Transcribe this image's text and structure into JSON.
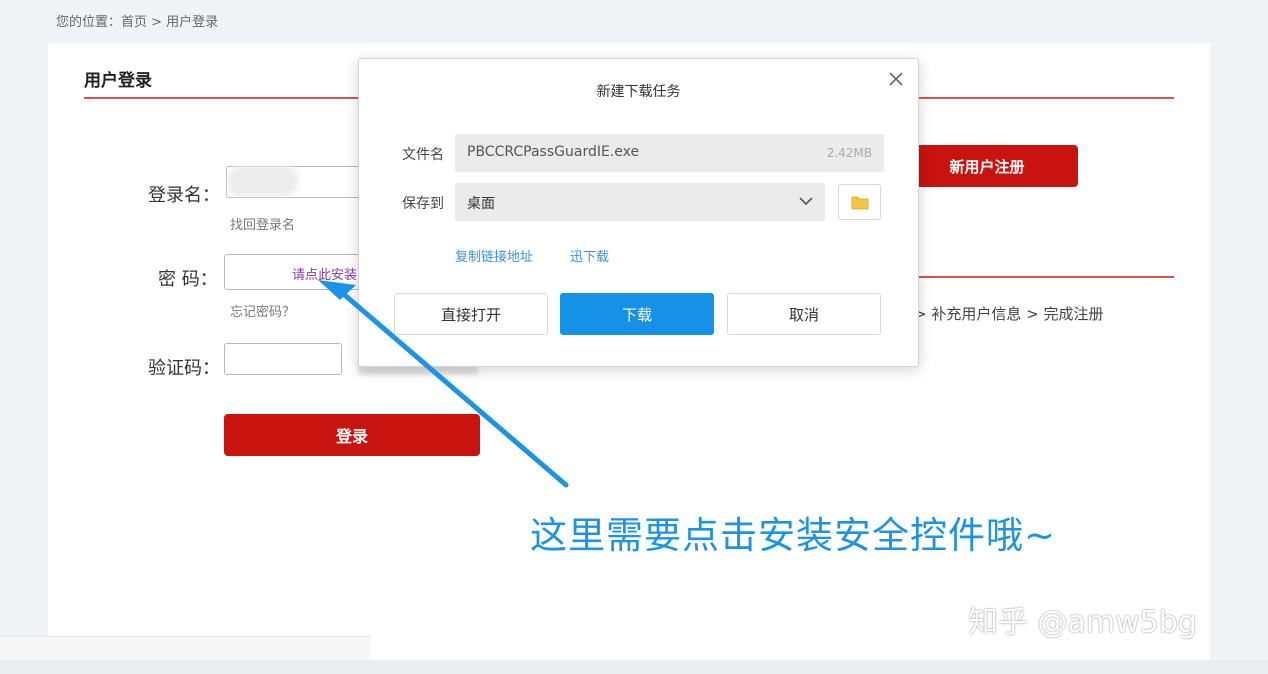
{
  "breadcrumb": "您的位置：首页 > 用户登录",
  "page": {
    "title": "用户登录",
    "register_button": "新用户注册",
    "register_steps": "> 补充用户信息 > 完成注册"
  },
  "login_form": {
    "username_label": "登录名：",
    "username_value": "",
    "find_username_link": "找回登录名",
    "password_label": "密 码：",
    "password_install_prompt": "请点此安装",
    "forgot_password_link": "忘记密码？",
    "captcha_label": "验证码：",
    "captcha_value": "",
    "login_button": "登录"
  },
  "download_dialog": {
    "title": "新建下载任务",
    "filename_label": "文件名",
    "filename_value": "PBCCRCPassGuardIE.exe",
    "filesize": "2.42MB",
    "save_to_label": "保存到",
    "save_to_value": "桌面",
    "copy_link": "复制链接地址",
    "other_download": "迅下载",
    "open_button": "直接打开",
    "download_button": "下载",
    "cancel_button": "取消"
  },
  "annotation": "这里需要点击安装安全控件哦~",
  "watermark": "知乎 @amw5bg",
  "colors": {
    "brand_red": "#c9130f",
    "dialog_blue": "#1592e8",
    "annotation_blue": "#1a93e8",
    "link_purple": "#8b3a9e"
  },
  "icons": {
    "close": "close-icon",
    "folder": "folder-icon",
    "chevron": "chevron-down-icon",
    "arrow": "arrow-annotation-icon"
  }
}
